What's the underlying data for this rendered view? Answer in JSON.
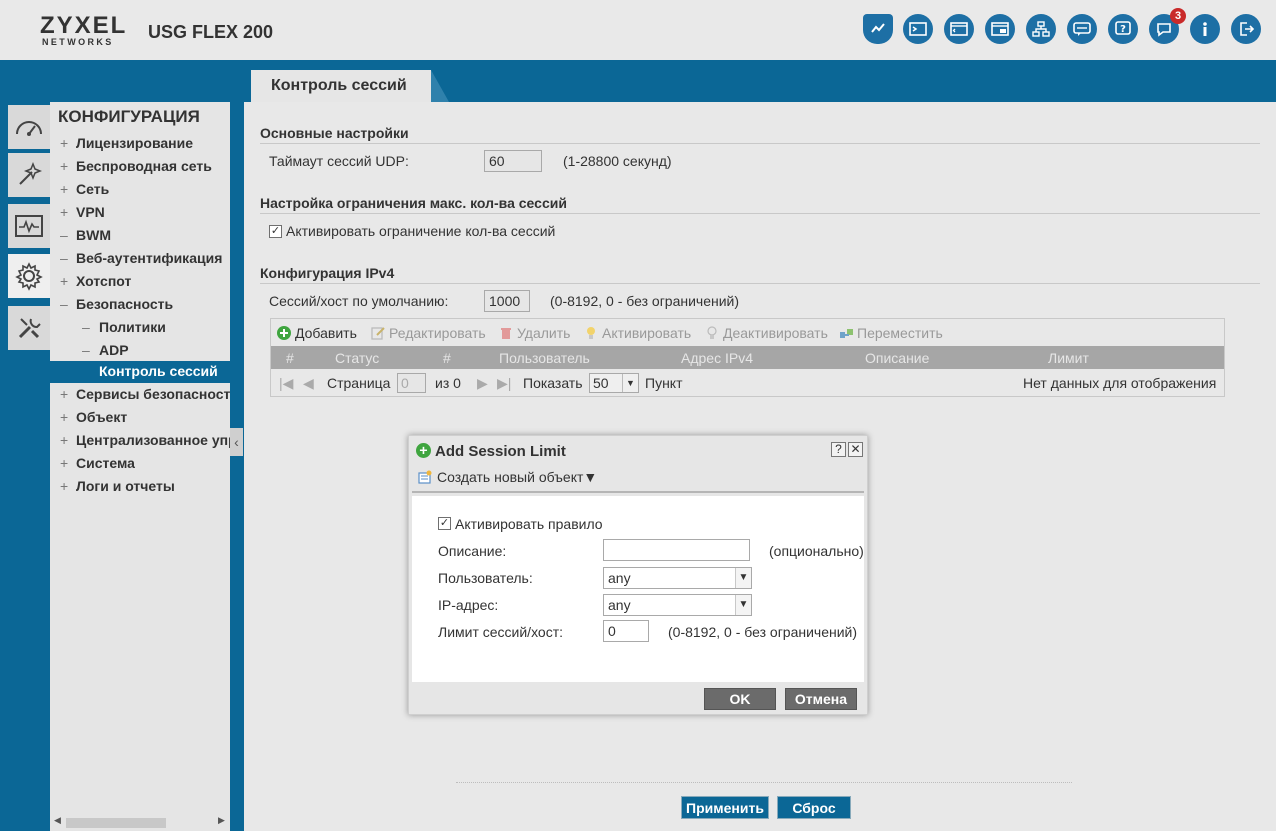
{
  "header": {
    "brand": "ZYXEL",
    "brand_sub": "NETWORKS",
    "model": "USG FLEX 200",
    "notification_count": "3",
    "icons": [
      "shield-icon",
      "console-icon",
      "cli-icon",
      "window-icon",
      "sitemap-icon",
      "chat-icon",
      "help-icon",
      "notification-icon",
      "info-icon",
      "logout-icon"
    ]
  },
  "tab": {
    "title": "Контроль сессий"
  },
  "rail": {
    "icons": [
      "dashboard-icon",
      "wizard-icon",
      "monitor-icon",
      "gear-icon",
      "tools-icon"
    ]
  },
  "nav": {
    "title": "КОНФИГУРАЦИЯ",
    "items": [
      {
        "pm": "+",
        "label": "Лицензирование"
      },
      {
        "pm": "+",
        "label": "Беспроводная сеть"
      },
      {
        "pm": "+",
        "label": "Сеть"
      },
      {
        "pm": "+",
        "label": "VPN"
      },
      {
        "pm": "–",
        "label": "BWM"
      },
      {
        "pm": "–",
        "label": "Веб-аутентификация"
      },
      {
        "pm": "+",
        "label": "Хотспот"
      },
      {
        "pm": "–",
        "label": "Безопасность"
      }
    ],
    "sub_items": [
      {
        "pm": "–",
        "label": "Политики"
      },
      {
        "pm": "–",
        "label": "ADP"
      }
    ],
    "active_item": "Контроль сессий",
    "items_after": [
      {
        "pm": "+",
        "label": "Сервисы безопасности"
      },
      {
        "pm": "+",
        "label": "Объект"
      },
      {
        "pm": "+",
        "label": "Централизованное управление"
      },
      {
        "pm": "+",
        "label": "Система"
      },
      {
        "pm": "+",
        "label": "Логи и отчеты"
      }
    ]
  },
  "main": {
    "general": {
      "title": "Основные настройки",
      "udp_label": "Таймаут сессий UDP:",
      "udp_value": "60",
      "udp_hint": "(1-28800 секунд)"
    },
    "limit": {
      "title": "Настройка ограничения макс. кол-ва сессий",
      "enable_label": "Активировать ограничение кол-ва сессий",
      "enable_checked": true
    },
    "ipv4": {
      "title": "Конфигурация IPv4",
      "default_label": "Сессий/хост по умолчанию:",
      "default_value": "1000",
      "default_hint": "(0-8192, 0 - без ограничений)"
    },
    "toolbar": {
      "add": "Добавить",
      "edit": "Редактировать",
      "delete": "Удалить",
      "activate": "Активировать",
      "deactivate": "Деактивировать",
      "move": "Переместить"
    },
    "columns": [
      "#",
      "Статус",
      "#",
      "Пользователь",
      "Адрес IPv4",
      "Описание",
      "Лимит"
    ],
    "pager": {
      "page_label": "Страница",
      "page_value": "0",
      "of_label": "из 0",
      "show_label": "Показать",
      "show_value": "50",
      "items_label": "Пункт",
      "empty_text": "Нет данных для отображения"
    },
    "apply": "Применить",
    "reset": "Сброс"
  },
  "dialog": {
    "title": "Add Session Limit",
    "help": "?",
    "close": "✕",
    "create_new": "Создать новый объект▼",
    "enable_label": "Активировать правило",
    "enable_checked": true,
    "description_label": "Описание:",
    "description_value": "",
    "description_hint": "(опционально)",
    "user_label": "Пользователь:",
    "user_value": "any",
    "ip_label": "IP-адрес:",
    "ip_value": "any",
    "limit_label": "Лимит сессий/хост:",
    "limit_value": "0",
    "limit_hint": "(0-8192, 0 - без ограничений)",
    "ok": "OK",
    "cancel": "Отмена"
  },
  "colors": {
    "primary": "#0b6796",
    "header_bg": "#e9e9e9",
    "grid_header": "#a6a6a6",
    "add_green": "#3fa53f",
    "badge_red": "#c92a2a"
  }
}
